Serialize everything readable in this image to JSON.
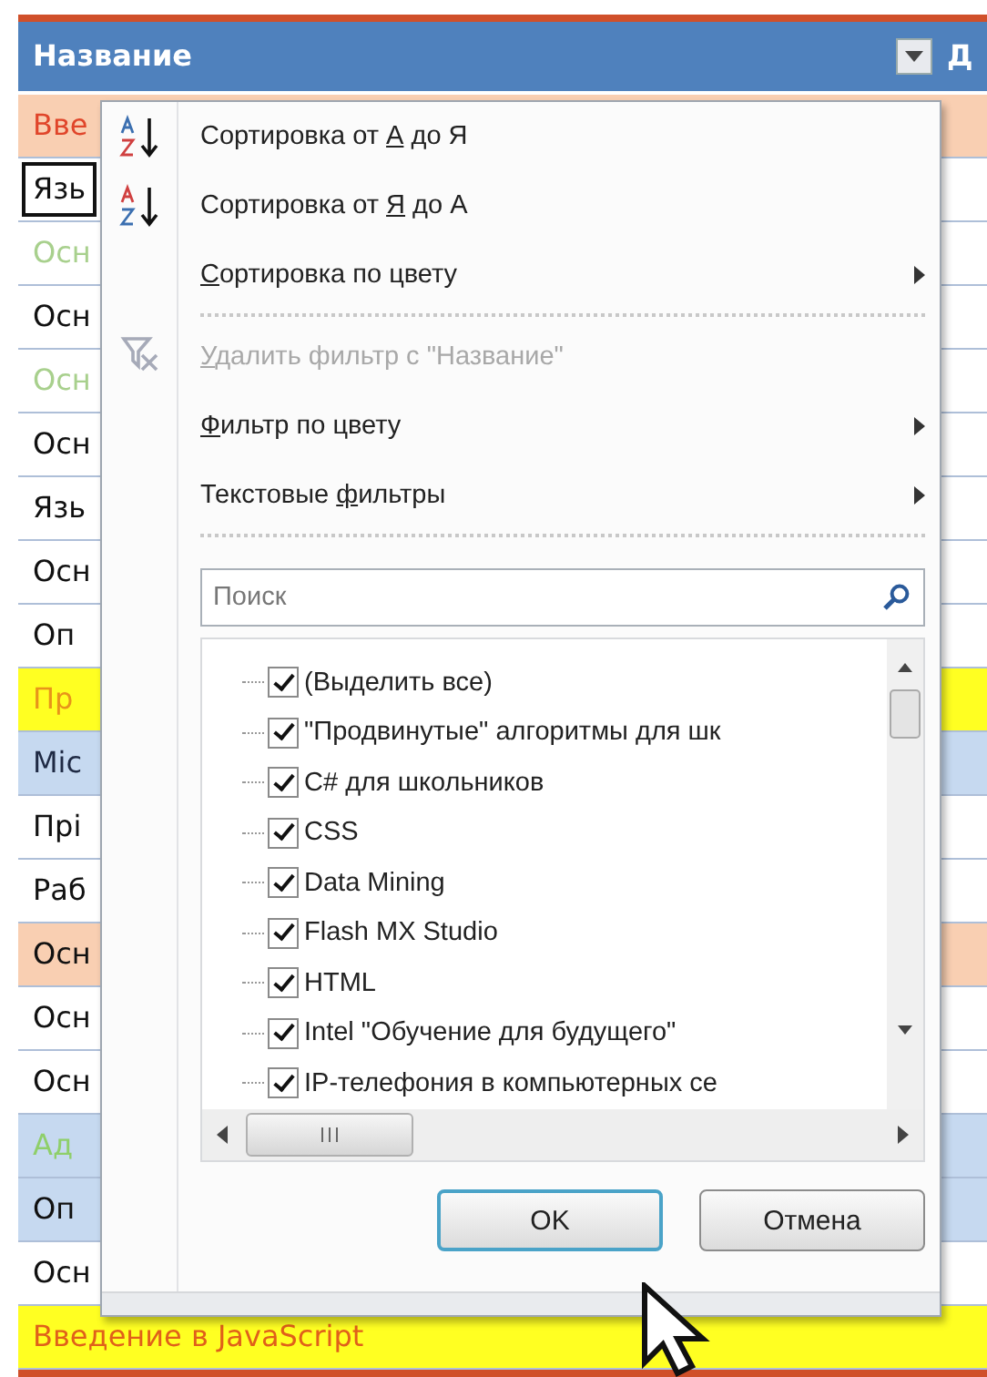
{
  "table": {
    "header": {
      "label": "Название",
      "next_label": "Д"
    },
    "rows": [
      {
        "text": "Вве",
        "kind": "peach",
        "color": "#e0452a",
        "selected": false
      },
      {
        "text": "Язь",
        "kind": "white",
        "color": "#111111",
        "selected": true
      },
      {
        "text": "Осн",
        "kind": "white",
        "color": "#a8d08d",
        "selected": false
      },
      {
        "text": "Осн",
        "kind": "white",
        "color": "#111111",
        "selected": false
      },
      {
        "text": "Осн",
        "kind": "white",
        "color": "#a8d08d",
        "selected": false
      },
      {
        "text": "Осн",
        "kind": "white",
        "color": "#111111",
        "selected": false
      },
      {
        "text": "Язь",
        "kind": "white",
        "color": "#111111",
        "selected": false
      },
      {
        "text": "Осн",
        "kind": "white",
        "color": "#111111",
        "selected": false
      },
      {
        "text": "Оп",
        "kind": "white",
        "color": "#111111",
        "selected": false
      },
      {
        "text": "Пр",
        "kind": "yellow",
        "color": "#e8941a",
        "selected": false
      },
      {
        "text": "Mic",
        "kind": "blue",
        "color": "#1f2a44",
        "selected": false
      },
      {
        "text": "Прі",
        "kind": "white",
        "color": "#111111",
        "selected": false
      },
      {
        "text": "Раб",
        "kind": "white",
        "color": "#111111",
        "selected": false
      },
      {
        "text": "Осн",
        "kind": "peach",
        "color": "#111111",
        "selected": false
      },
      {
        "text": "Осн",
        "kind": "white",
        "color": "#111111",
        "selected": false
      },
      {
        "text": "Осн",
        "kind": "white",
        "color": "#111111",
        "selected": false
      },
      {
        "text": "Ад",
        "kind": "blue",
        "color": "#8fcf6a",
        "selected": false
      },
      {
        "text": "Оп",
        "kind": "blue",
        "color": "#111111",
        "selected": false
      },
      {
        "text": "Осн",
        "kind": "white",
        "color": "#111111",
        "selected": false
      },
      {
        "text": "Введение в JavaScript",
        "kind": "yellow",
        "color": "#e0601a",
        "selected": false
      }
    ]
  },
  "filter_menu": {
    "items": [
      {
        "kind": "sort-az",
        "before": "Сортировка от ",
        "key": "А",
        "after": " до Я",
        "submenu": false,
        "disabled": false
      },
      {
        "kind": "sort-za",
        "before": "Сортировка от ",
        "key": "Я",
        "after": " до А",
        "submenu": false,
        "disabled": false
      },
      {
        "kind": "plain",
        "key": "С",
        "after": "ортировка по цвету",
        "submenu": true,
        "disabled": false
      },
      {
        "kind": "separator"
      },
      {
        "kind": "clear-filter",
        "key": "У",
        "after": "далить фильтр с \"Название\"",
        "submenu": false,
        "disabled": true
      },
      {
        "kind": "plain",
        "key": "Ф",
        "after": "ильтр по цвету",
        "submenu": true,
        "disabled": false
      },
      {
        "kind": "plain",
        "before": "Текстовые ",
        "key": "ф",
        "after": "ильтры",
        "submenu": true,
        "disabled": false
      }
    ],
    "search": {
      "placeholder": "Поиск"
    },
    "values": [
      {
        "label": "(Выделить все)",
        "checked": true
      },
      {
        "label": "\"Продвинутые\" алгоритмы для шк",
        "checked": true
      },
      {
        "label": "C# для школьников",
        "checked": true
      },
      {
        "label": "CSS",
        "checked": true
      },
      {
        "label": "Data Mining",
        "checked": true
      },
      {
        "label": "Flash MX Studio",
        "checked": true
      },
      {
        "label": "HTML",
        "checked": true
      },
      {
        "label": "Intel \"Обучение для будущего\"",
        "checked": true
      },
      {
        "label": "IP-телефония в компьютерных се",
        "checked": true
      }
    ],
    "buttons": [
      {
        "label": "OK",
        "default": true
      },
      {
        "label": "Отмена",
        "default": false
      }
    ]
  }
}
